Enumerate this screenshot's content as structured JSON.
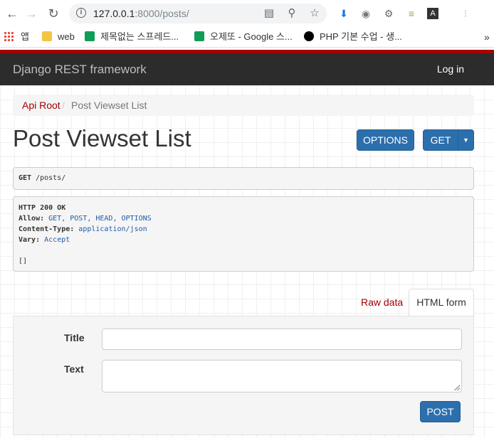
{
  "browser": {
    "url_host": "127.0.0.1",
    "url_path": ":8000/posts/",
    "bookmarks": [
      "앱",
      "web",
      "제목없는 스프레드...",
      "오제또 - Google 스...",
      "PHP 기본 수업 - 생..."
    ],
    "overflow": "»"
  },
  "navbar": {
    "brand": "Django REST framework",
    "login": "Log in"
  },
  "breadcrumb": {
    "root": "Api Root",
    "separator": "/",
    "current": "Post Viewset List"
  },
  "page": {
    "title": "Post Viewset List",
    "options_label": "OPTIONS",
    "get_label": "GET"
  },
  "request": {
    "method": "GET",
    "path": " /posts/"
  },
  "response": {
    "status": "HTTP 200 OK",
    "allow_key": "Allow:",
    "allow_value": " GET, POST, HEAD, OPTIONS",
    "content_type_key": "Content-Type:",
    "content_type_value": " application/json",
    "vary_key": "Vary:",
    "vary_value": " Accept",
    "body": "[]"
  },
  "form": {
    "tab_raw": "Raw data",
    "tab_html": "HTML form",
    "title_label": "Title",
    "text_label": "Text",
    "submit_label": "POST"
  },
  "colors": {
    "brand_red": "#a30000",
    "button_blue": "#2c6fad",
    "navbar_bg": "#2c2c2c"
  }
}
